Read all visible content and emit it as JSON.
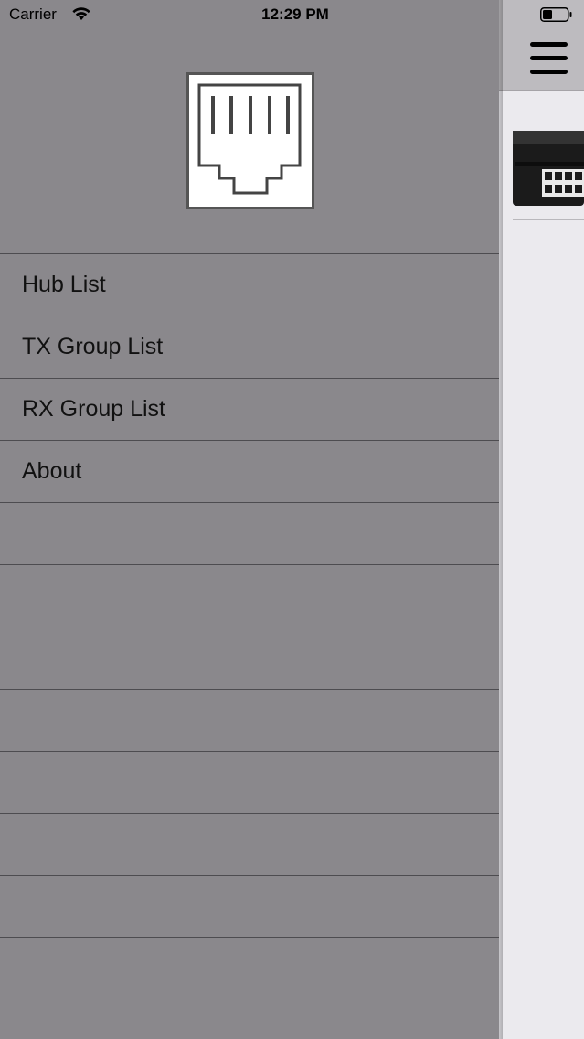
{
  "status_bar": {
    "carrier": "Carrier",
    "time": "12:29 PM",
    "wifi_icon": "wifi-icon",
    "battery_icon": "battery-icon"
  },
  "drawer": {
    "logo_icon": "ethernet-port-icon",
    "menu_items": [
      {
        "label": "Hub List"
      },
      {
        "label": "TX Group List"
      },
      {
        "label": "RX Group List"
      },
      {
        "label": "About"
      },
      {
        "label": ""
      },
      {
        "label": ""
      },
      {
        "label": ""
      },
      {
        "label": ""
      },
      {
        "label": ""
      },
      {
        "label": ""
      },
      {
        "label": ""
      },
      {
        "label": ""
      }
    ]
  },
  "main": {
    "menu_icon": "hamburger-menu-icon",
    "thumbnail": "network-switch-image"
  },
  "colors": {
    "drawer_bg": "#8a888c",
    "header_bg": "#bdbbbf",
    "main_bg": "#ebeaee",
    "separator": "#4d4c50"
  }
}
